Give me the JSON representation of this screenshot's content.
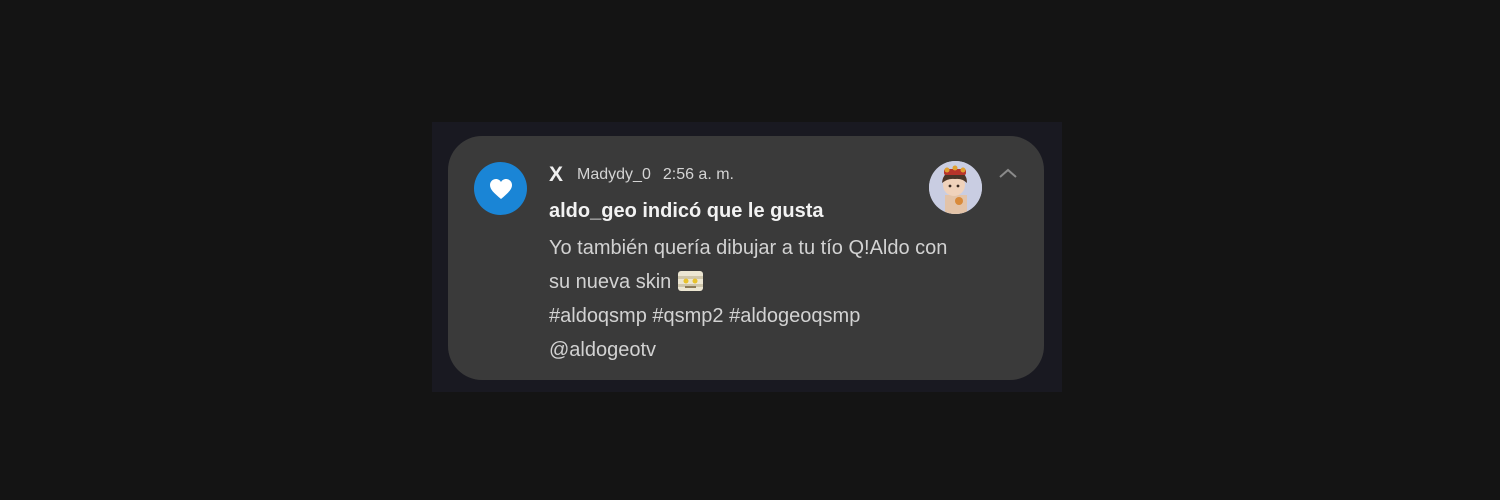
{
  "notification": {
    "app_name": "X",
    "app_icon": "heart-icon",
    "accent_color": "#1a85d6",
    "username": "Madydy_0",
    "time": "2:56 a. m.",
    "title": "aldo_geo indicó que le gusta",
    "body_lines": [
      "Yo también quería dibujar a tu tío Q!Aldo con",
      "su nueva skin",
      "#aldoqsmp #qsmp2 #aldogeoqsmp",
      "@aldogeotv"
    ],
    "emoji": "mummy-face-emoji",
    "expand_icon": "chevron-up-icon",
    "avatar": "user-avatar"
  }
}
